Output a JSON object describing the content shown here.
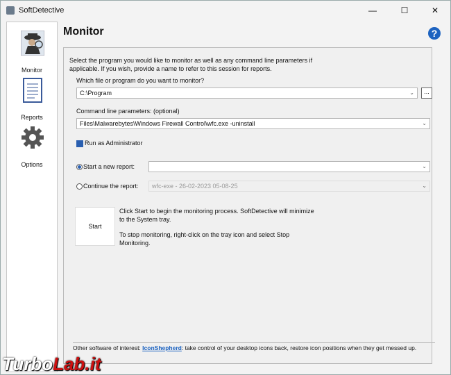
{
  "window": {
    "title": "SoftDetective",
    "minimize": "—",
    "maximize": "☐",
    "close": "✕"
  },
  "sidebar": {
    "items": [
      {
        "label": "Monitor",
        "icon": "spy-icon"
      },
      {
        "label": "Reports",
        "icon": "notebook-icon"
      },
      {
        "label": "Options",
        "icon": "gear-icon"
      }
    ]
  },
  "main": {
    "heading": "Monitor",
    "help": "?",
    "intro": "Select the program you would like to monitor as well as any command line parameters if applicable. If you wish, provide a name to refer to this session for reports.",
    "program_label": "Which file or program do you want to monitor?",
    "program_value": "C:\\Program",
    "browse": "...",
    "params_label": "Command line parameters: (optional)",
    "params_value": "Files\\Malwarebytes\\Windows Firewall Control\\wfc.exe -uninstall",
    "run_admin": "Run as Administrator",
    "new_report_label": "Start a new report:",
    "new_report_value": "",
    "continue_label": "Continue the report:",
    "continue_value": "wfc-exe - 26-02-2023 05-08-25",
    "start_button": "Start",
    "info1": "Click Start to begin the monitoring process. SoftDetective will minimize to the System tray.",
    "info2": "To stop monitoring, right-click on the tray icon and select Stop Monitoring."
  },
  "footer": {
    "prefix": "Other software of interest:",
    "link": "IconShepherd",
    "suffix": ": take control of your desktop icons back, restore icon positions when they get messed up."
  },
  "watermark": {
    "part1": "Turbo",
    "part2": "Lab.it"
  }
}
